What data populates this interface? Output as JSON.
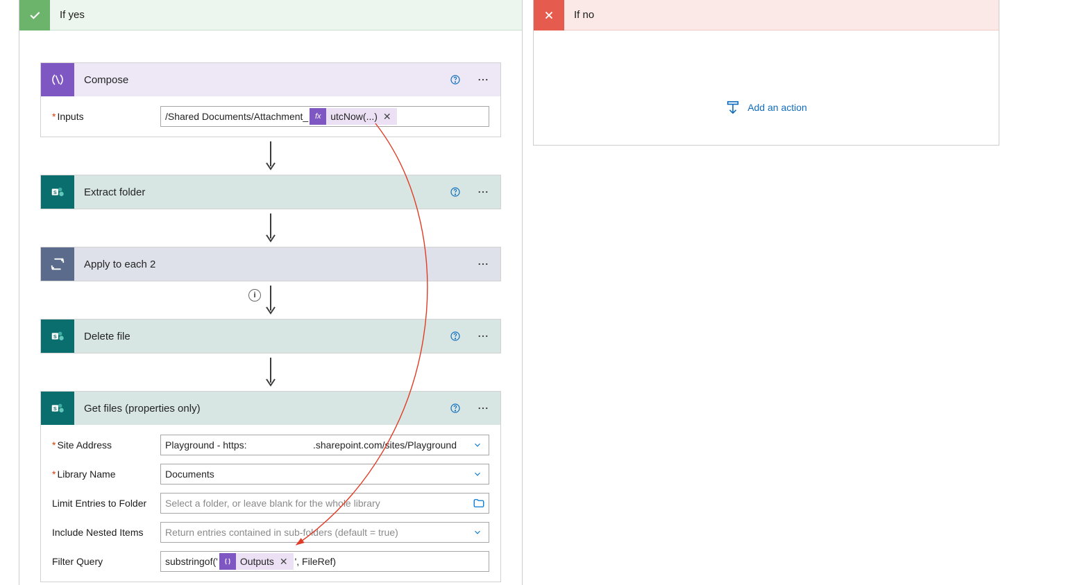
{
  "condition": {
    "yes_title": "If yes",
    "no_title": "If no"
  },
  "compose": {
    "title": "Compose",
    "field_label": "Inputs",
    "text_before": "/Shared Documents/Attachment_",
    "token_label": "utcNow(...)"
  },
  "extract_folder": {
    "title": "Extract folder"
  },
  "apply_each": {
    "title": "Apply to each 2"
  },
  "delete_file": {
    "title": "Delete file"
  },
  "get_files": {
    "title": "Get files (properties only)",
    "fields": {
      "site": {
        "label": "Site Address",
        "value_left": "Playground - https:",
        "value_right": ".sharepoint.com/sites/Playground"
      },
      "library": {
        "label": "Library Name",
        "value": "Documents"
      },
      "limit": {
        "label": "Limit Entries to Folder",
        "placeholder": "Select a folder, or leave blank for the whole library"
      },
      "nested": {
        "label": "Include Nested Items",
        "placeholder": "Return entries contained in sub-folders (default = true)"
      },
      "filter": {
        "label": "Filter Query",
        "prefix": "substringof('",
        "token": "Outputs",
        "suffix": "', FileRef)"
      }
    }
  },
  "no_branch": {
    "add_action": "Add an action"
  },
  "icons": {
    "fx": "fx",
    "compose": "{ }"
  }
}
